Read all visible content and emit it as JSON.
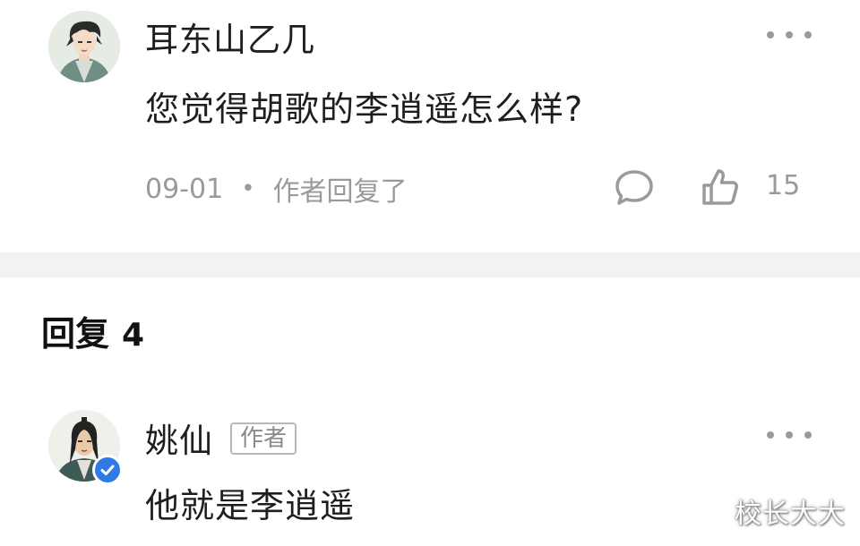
{
  "top_comment": {
    "username": "耳东山乙几",
    "text": "您觉得胡歌的李逍遥怎么样?",
    "date": "09-01",
    "separator": "•",
    "author_replied": "作者回复了",
    "like_count": "15",
    "icons": [
      "avatar",
      "more-dots-icon",
      "comment-bubble-icon",
      "thumbs-up-icon"
    ]
  },
  "replies": {
    "label": "回复",
    "count": "4"
  },
  "reply": {
    "username": "姚仙",
    "author_tag": "作者",
    "text": "他就是李逍遥",
    "verified_color": "#2f7ae5"
  },
  "watermark": "校长大大",
  "colors": {
    "text_primary": "#1e1e1e",
    "text_secondary": "#9a9a9a",
    "divider": "#f2f2f2",
    "verified_badge": "#2f7ae5"
  }
}
